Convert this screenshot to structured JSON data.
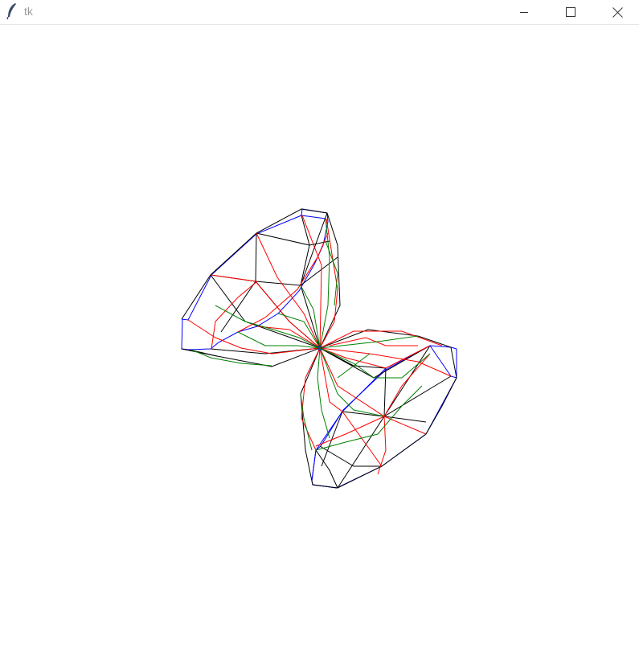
{
  "window": {
    "title": "tk",
    "app_icon": "feather-icon",
    "controls": {
      "minimize_icon": "minimize-icon",
      "maximize_icon": "maximize-icon",
      "close_icon": "close-icon"
    }
  },
  "colors": {
    "background": "#ffffff",
    "title_text": "#9a9a9a",
    "wire_black": "#000000",
    "wire_red": "#ff0000",
    "wire_green": "#008000",
    "wire_blue": "#0000ff"
  }
}
